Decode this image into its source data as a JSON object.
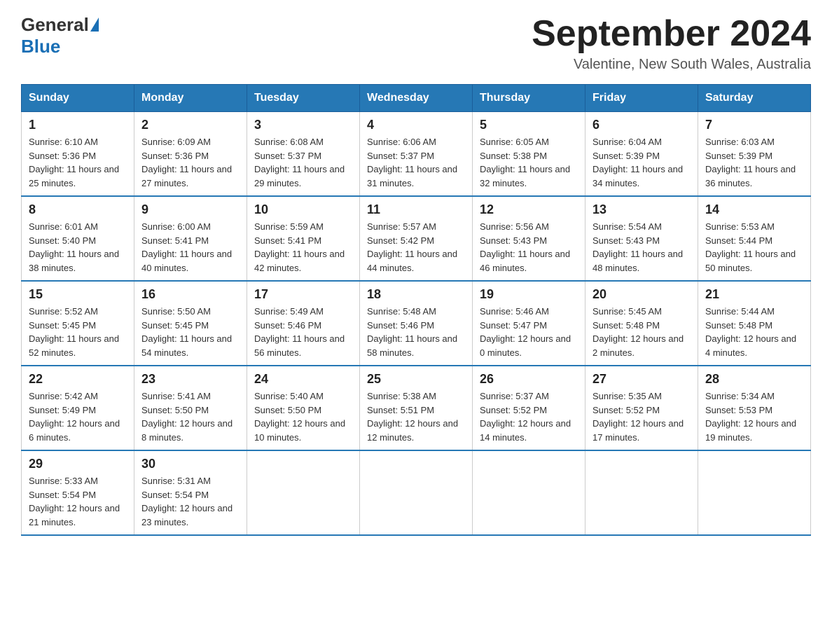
{
  "header": {
    "logo_general": "General",
    "logo_blue": "Blue",
    "month_title": "September 2024",
    "location": "Valentine, New South Wales, Australia"
  },
  "days_of_week": [
    "Sunday",
    "Monday",
    "Tuesday",
    "Wednesday",
    "Thursday",
    "Friday",
    "Saturday"
  ],
  "weeks": [
    [
      {
        "day": "1",
        "sunrise": "Sunrise: 6:10 AM",
        "sunset": "Sunset: 5:36 PM",
        "daylight": "Daylight: 11 hours and 25 minutes."
      },
      {
        "day": "2",
        "sunrise": "Sunrise: 6:09 AM",
        "sunset": "Sunset: 5:36 PM",
        "daylight": "Daylight: 11 hours and 27 minutes."
      },
      {
        "day": "3",
        "sunrise": "Sunrise: 6:08 AM",
        "sunset": "Sunset: 5:37 PM",
        "daylight": "Daylight: 11 hours and 29 minutes."
      },
      {
        "day": "4",
        "sunrise": "Sunrise: 6:06 AM",
        "sunset": "Sunset: 5:37 PM",
        "daylight": "Daylight: 11 hours and 31 minutes."
      },
      {
        "day": "5",
        "sunrise": "Sunrise: 6:05 AM",
        "sunset": "Sunset: 5:38 PM",
        "daylight": "Daylight: 11 hours and 32 minutes."
      },
      {
        "day": "6",
        "sunrise": "Sunrise: 6:04 AM",
        "sunset": "Sunset: 5:39 PM",
        "daylight": "Daylight: 11 hours and 34 minutes."
      },
      {
        "day": "7",
        "sunrise": "Sunrise: 6:03 AM",
        "sunset": "Sunset: 5:39 PM",
        "daylight": "Daylight: 11 hours and 36 minutes."
      }
    ],
    [
      {
        "day": "8",
        "sunrise": "Sunrise: 6:01 AM",
        "sunset": "Sunset: 5:40 PM",
        "daylight": "Daylight: 11 hours and 38 minutes."
      },
      {
        "day": "9",
        "sunrise": "Sunrise: 6:00 AM",
        "sunset": "Sunset: 5:41 PM",
        "daylight": "Daylight: 11 hours and 40 minutes."
      },
      {
        "day": "10",
        "sunrise": "Sunrise: 5:59 AM",
        "sunset": "Sunset: 5:41 PM",
        "daylight": "Daylight: 11 hours and 42 minutes."
      },
      {
        "day": "11",
        "sunrise": "Sunrise: 5:57 AM",
        "sunset": "Sunset: 5:42 PM",
        "daylight": "Daylight: 11 hours and 44 minutes."
      },
      {
        "day": "12",
        "sunrise": "Sunrise: 5:56 AM",
        "sunset": "Sunset: 5:43 PM",
        "daylight": "Daylight: 11 hours and 46 minutes."
      },
      {
        "day": "13",
        "sunrise": "Sunrise: 5:54 AM",
        "sunset": "Sunset: 5:43 PM",
        "daylight": "Daylight: 11 hours and 48 minutes."
      },
      {
        "day": "14",
        "sunrise": "Sunrise: 5:53 AM",
        "sunset": "Sunset: 5:44 PM",
        "daylight": "Daylight: 11 hours and 50 minutes."
      }
    ],
    [
      {
        "day": "15",
        "sunrise": "Sunrise: 5:52 AM",
        "sunset": "Sunset: 5:45 PM",
        "daylight": "Daylight: 11 hours and 52 minutes."
      },
      {
        "day": "16",
        "sunrise": "Sunrise: 5:50 AM",
        "sunset": "Sunset: 5:45 PM",
        "daylight": "Daylight: 11 hours and 54 minutes."
      },
      {
        "day": "17",
        "sunrise": "Sunrise: 5:49 AM",
        "sunset": "Sunset: 5:46 PM",
        "daylight": "Daylight: 11 hours and 56 minutes."
      },
      {
        "day": "18",
        "sunrise": "Sunrise: 5:48 AM",
        "sunset": "Sunset: 5:46 PM",
        "daylight": "Daylight: 11 hours and 58 minutes."
      },
      {
        "day": "19",
        "sunrise": "Sunrise: 5:46 AM",
        "sunset": "Sunset: 5:47 PM",
        "daylight": "Daylight: 12 hours and 0 minutes."
      },
      {
        "day": "20",
        "sunrise": "Sunrise: 5:45 AM",
        "sunset": "Sunset: 5:48 PM",
        "daylight": "Daylight: 12 hours and 2 minutes."
      },
      {
        "day": "21",
        "sunrise": "Sunrise: 5:44 AM",
        "sunset": "Sunset: 5:48 PM",
        "daylight": "Daylight: 12 hours and 4 minutes."
      }
    ],
    [
      {
        "day": "22",
        "sunrise": "Sunrise: 5:42 AM",
        "sunset": "Sunset: 5:49 PM",
        "daylight": "Daylight: 12 hours and 6 minutes."
      },
      {
        "day": "23",
        "sunrise": "Sunrise: 5:41 AM",
        "sunset": "Sunset: 5:50 PM",
        "daylight": "Daylight: 12 hours and 8 minutes."
      },
      {
        "day": "24",
        "sunrise": "Sunrise: 5:40 AM",
        "sunset": "Sunset: 5:50 PM",
        "daylight": "Daylight: 12 hours and 10 minutes."
      },
      {
        "day": "25",
        "sunrise": "Sunrise: 5:38 AM",
        "sunset": "Sunset: 5:51 PM",
        "daylight": "Daylight: 12 hours and 12 minutes."
      },
      {
        "day": "26",
        "sunrise": "Sunrise: 5:37 AM",
        "sunset": "Sunset: 5:52 PM",
        "daylight": "Daylight: 12 hours and 14 minutes."
      },
      {
        "day": "27",
        "sunrise": "Sunrise: 5:35 AM",
        "sunset": "Sunset: 5:52 PM",
        "daylight": "Daylight: 12 hours and 17 minutes."
      },
      {
        "day": "28",
        "sunrise": "Sunrise: 5:34 AM",
        "sunset": "Sunset: 5:53 PM",
        "daylight": "Daylight: 12 hours and 19 minutes."
      }
    ],
    [
      {
        "day": "29",
        "sunrise": "Sunrise: 5:33 AM",
        "sunset": "Sunset: 5:54 PM",
        "daylight": "Daylight: 12 hours and 21 minutes."
      },
      {
        "day": "30",
        "sunrise": "Sunrise: 5:31 AM",
        "sunset": "Sunset: 5:54 PM",
        "daylight": "Daylight: 12 hours and 23 minutes."
      },
      null,
      null,
      null,
      null,
      null
    ]
  ]
}
